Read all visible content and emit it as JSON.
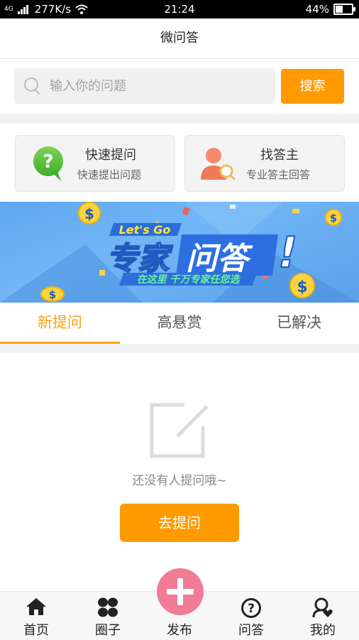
{
  "status_bar": {
    "network": "4G",
    "speed": "277K/s",
    "time": "21:24",
    "battery": "44%",
    "battery_level": 0.44
  },
  "header": {
    "title": "微问答"
  },
  "search": {
    "placeholder": "输入你的问题",
    "button_label": "搜索"
  },
  "quick_cards": [
    {
      "title": "快速提问",
      "subtitle": "快速提出问题",
      "icon": "question-bubble-icon"
    },
    {
      "title": "找答主",
      "subtitle": "专业答主回答",
      "icon": "expert-search-icon"
    }
  ],
  "banner": {
    "tagline": "Let's Go",
    "headline_left": "专家",
    "headline_right": "问答",
    "subline": "在这里 千万专家任您选",
    "accent_color": "#3b7fe0"
  },
  "tabs": [
    {
      "label": "新提问",
      "active": true
    },
    {
      "label": "高悬赏",
      "active": false
    },
    {
      "label": "已解决",
      "active": false
    }
  ],
  "empty_state": {
    "message": "还没有人提问哦~",
    "button_label": "去提问",
    "icon": "edit-icon"
  },
  "bottom_nav": [
    {
      "label": "首页",
      "icon": "home-icon"
    },
    {
      "label": "圈子",
      "icon": "circle-icon"
    },
    {
      "label": "发布",
      "icon": "plus-icon"
    },
    {
      "label": "问答",
      "icon": "question-icon"
    },
    {
      "label": "我的",
      "icon": "profile-icon"
    }
  ],
  "colors": {
    "accent": "#ff9a00",
    "tab_active": "#f4a21a",
    "fab": "#f07c96"
  }
}
